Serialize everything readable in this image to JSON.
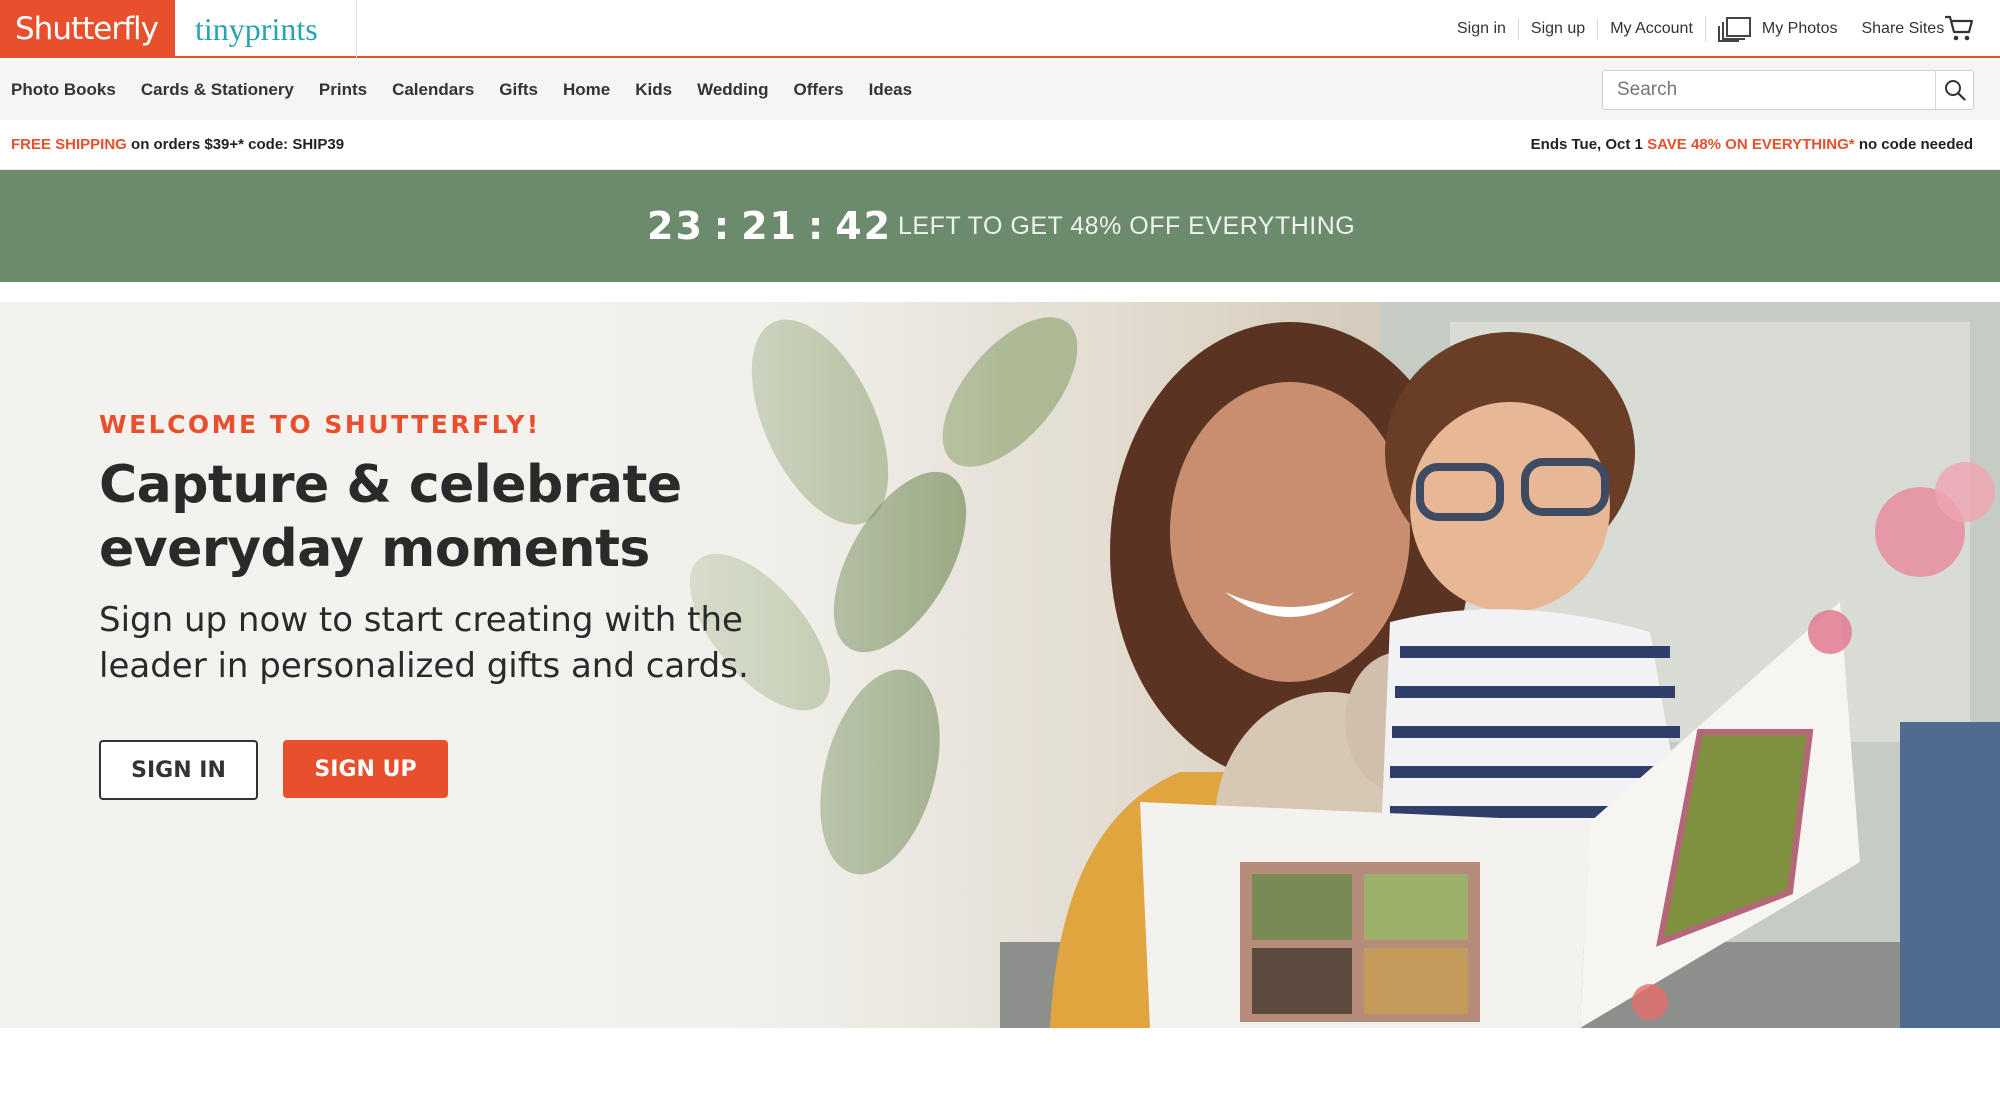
{
  "brand": {
    "primary_logo": "Shutterfly",
    "secondary_logo": "tinyprints",
    "accent_color": "#e8502d",
    "secondary_color": "#2aa3b0"
  },
  "utility_nav": {
    "sign_in": "Sign in",
    "sign_up": "Sign up",
    "my_account": "My Account",
    "my_photos": "My Photos",
    "share_sites": "Share Sites",
    "photos_icon": "photos-stack-icon",
    "cart_icon": "cart-icon"
  },
  "main_nav": {
    "items": [
      "Photo Books",
      "Cards & Stationery",
      "Prints",
      "Calendars",
      "Gifts",
      "Home",
      "Kids",
      "Wedding",
      "Offers",
      "Ideas"
    ]
  },
  "search": {
    "placeholder": "Search",
    "value": "",
    "icon": "search-icon"
  },
  "promo": {
    "shipping_highlight": "FREE SHIPPING",
    "shipping_rest": "on orders $39+* code: SHIP39",
    "ends": "Ends Tue, Oct 1",
    "sale_highlight": "SAVE 48% ON EVERYTHING*",
    "sale_rest": "no code needed"
  },
  "countdown": {
    "hours": "23",
    "minutes": "21",
    "seconds": "42",
    "message": "LEFT TO GET 48% OFF EVERYTHING",
    "background": "#6c8a6c"
  },
  "hero": {
    "eyebrow": "WELCOME TO SHUTTERFLY!",
    "headline_line1": "Capture & celebrate",
    "headline_line2": "everyday moments",
    "subhead_line1": "Sign up now to start creating with the",
    "subhead_line2": "leader in personalized gifts and cards.",
    "sign_in_label": "SIGN IN",
    "sign_up_label": "SIGN UP"
  }
}
